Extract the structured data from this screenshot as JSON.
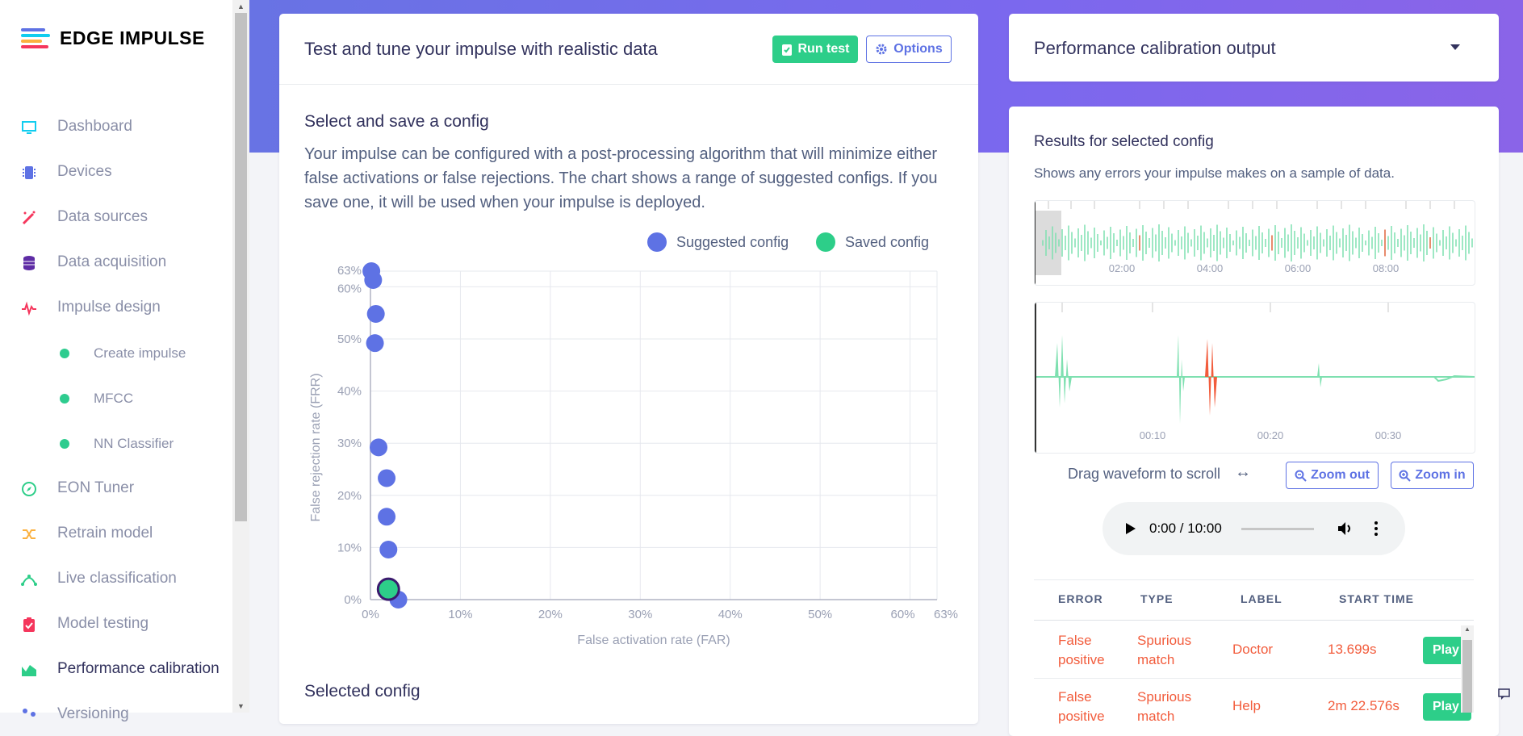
{
  "sidebar": {
    "logo": "EDGE IMPULSE",
    "items": [
      {
        "label": "Dashboard",
        "icon": "monitor-icon",
        "color": "#11cdef"
      },
      {
        "label": "Devices",
        "icon": "chip-icon",
        "color": "#5e72e4"
      },
      {
        "label": "Data sources",
        "icon": "wand-icon",
        "color": "#f5365c"
      },
      {
        "label": "Data acquisition",
        "icon": "database-icon",
        "color": "#5e2ca5"
      },
      {
        "label": "Impulse design",
        "icon": "pulse-icon",
        "color": "#f5365c"
      },
      {
        "label": "Create impulse",
        "icon": "dot-icon",
        "color": "#2dce89"
      },
      {
        "label": "MFCC",
        "icon": "dot-icon",
        "color": "#2dce89"
      },
      {
        "label": "NN Classifier",
        "icon": "dot-icon",
        "color": "#2dce89"
      },
      {
        "label": "EON Tuner",
        "icon": "compass-icon",
        "color": "#2dce89"
      },
      {
        "label": "Retrain model",
        "icon": "shuffle-icon",
        "color": "#fbb140"
      },
      {
        "label": "Live classification",
        "icon": "live-icon",
        "color": "#2dce89"
      },
      {
        "label": "Model testing",
        "icon": "clipboard-icon",
        "color": "#f5365c"
      },
      {
        "label": "Performance calibration",
        "icon": "area-chart-icon",
        "color": "#2dce89"
      },
      {
        "label": "Versioning",
        "icon": "versioning-icon",
        "color": "#5e72e4"
      }
    ]
  },
  "main": {
    "title": "Test and tune your impulse with realistic data",
    "run_test": "Run test",
    "options": "Options",
    "section_title": "Select and save a config",
    "description": "Your impulse can be configured with a post-processing algorithm that will minimize either false activations or false rejections. The chart shows a range of suggested configs. If you save one, it will be used when your impulse is deployed.",
    "selected_config": "Selected config"
  },
  "chart_data": {
    "type": "scatter",
    "xlabel": "False activation rate (FAR)",
    "ylabel": "False rejection rate (FRR)",
    "xlim": [
      0,
      63
    ],
    "ylim": [
      0,
      63
    ],
    "x_ticks": [
      "0%",
      "10%",
      "20%",
      "30%",
      "40%",
      "50%",
      "60%",
      "63%"
    ],
    "y_ticks": [
      "0%",
      "10%",
      "20%",
      "30%",
      "40%",
      "50%",
      "60%",
      "63%"
    ],
    "grid": true,
    "legend_position": "top-right",
    "series": [
      {
        "name": "Suggested config",
        "color": "#5e72e4",
        "points": [
          [
            0.1,
            63
          ],
          [
            0.3,
            61.3
          ],
          [
            0.6,
            54.8
          ],
          [
            0.5,
            49.2
          ],
          [
            0.9,
            29.2
          ],
          [
            1.8,
            23.3
          ],
          [
            1.8,
            15.9
          ],
          [
            2.0,
            9.6
          ],
          [
            3.1,
            0
          ]
        ]
      },
      {
        "name": "Saved config",
        "color": "#2dce89",
        "points": [
          [
            2.0,
            2.0
          ]
        ]
      }
    ]
  },
  "right": {
    "calibration_title": "Performance calibration output",
    "results_title": "Results for selected config",
    "results_desc": "Shows any errors your impulse makes on a sample of data.",
    "overview_ticks": [
      "02:00",
      "04:00",
      "06:00",
      "08:00"
    ],
    "detail_ticks": [
      "00:10",
      "00:20",
      "00:30"
    ],
    "drag_hint": "Drag waveform to scroll",
    "zoom_out": "Zoom out",
    "zoom_in": "Zoom in",
    "audio_time": "0:00 / 10:00",
    "table": {
      "headers": [
        "ERROR",
        "TYPE",
        "LABEL",
        "START TIME"
      ],
      "rows": [
        {
          "error": "False positive",
          "type": "Spurious match",
          "label": "Doctor",
          "start": "13.699s",
          "action": "Play"
        },
        {
          "error": "False positive",
          "type": "Spurious match",
          "label": "Help",
          "start": "2m 22.576s",
          "action": "Play"
        }
      ]
    }
  }
}
